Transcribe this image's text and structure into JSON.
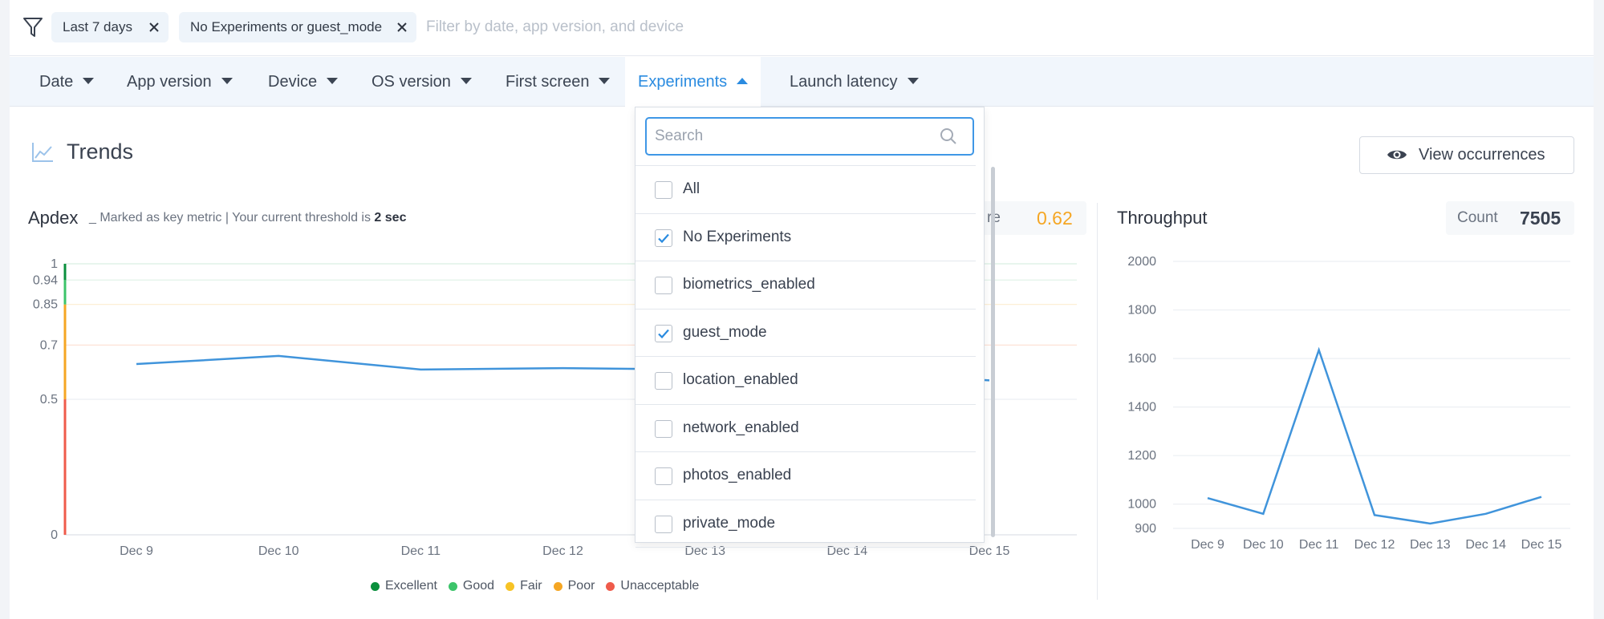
{
  "filters": {
    "chips": [
      {
        "label": "Last 7 days"
      },
      {
        "label": "No Experiments or guest_mode"
      }
    ],
    "placeholder": "Filter by date, app version, and device"
  },
  "nav": {
    "items": [
      {
        "label": "Date"
      },
      {
        "label": "App version"
      },
      {
        "label": "Device"
      },
      {
        "label": "OS version"
      },
      {
        "label": "First screen"
      },
      {
        "label": "Experiments",
        "active": true
      },
      {
        "label": "Launch latency"
      }
    ]
  },
  "trends": {
    "title": "Trends",
    "view_button": "View occurrences"
  },
  "apdex": {
    "title": "Apdex",
    "subtitle_prefix": "_ Marked as key metric | Your current threshold is ",
    "threshold": "2 sec",
    "score_label": "re",
    "score_value": "0.62",
    "score_color": "#f5a623",
    "legend": [
      {
        "label": "Excellent",
        "color": "#0a8f3c"
      },
      {
        "label": "Good",
        "color": "#3cc46a"
      },
      {
        "label": "Fair",
        "color": "#f7c325"
      },
      {
        "label": "Poor",
        "color": "#f5a623"
      },
      {
        "label": "Unacceptable",
        "color": "#ef5b4b"
      }
    ]
  },
  "throughput": {
    "title": "Throughput",
    "count_label": "Count",
    "count_value": "7505"
  },
  "experiments_dropdown": {
    "search_placeholder": "Search",
    "options": [
      {
        "label": "All",
        "checked": false
      },
      {
        "label": "No Experiments",
        "checked": true
      },
      {
        "label": "biometrics_enabled",
        "checked": false
      },
      {
        "label": "guest_mode",
        "checked": true
      },
      {
        "label": "location_enabled",
        "checked": false
      },
      {
        "label": "network_enabled",
        "checked": false
      },
      {
        "label": "photos_enabled",
        "checked": false
      },
      {
        "label": "private_mode",
        "checked": false
      }
    ]
  },
  "chart_data": [
    {
      "type": "line",
      "title": "Apdex",
      "x": [
        "Dec 9",
        "Dec 10",
        "Dec 11",
        "Dec 12",
        "Dec 13",
        "Dec 14",
        "Dec 15"
      ],
      "series": [
        {
          "values": [
            0.63,
            0.66,
            0.61,
            0.615,
            0.61,
            0.6,
            0.57
          ],
          "color": "#4094db"
        }
      ],
      "y_ticks": [
        0,
        0.5,
        0.7,
        0.85,
        0.94,
        1
      ],
      "y_tick_labels": [
        "0",
        "0.5",
        "0.7",
        "0.85",
        "0.94",
        "1"
      ],
      "ylim": [
        0,
        1
      ]
    },
    {
      "type": "line",
      "title": "Throughput",
      "x": [
        "Dec 9",
        "Dec 10",
        "Dec 11",
        "Dec 12",
        "Dec 13",
        "Dec 14",
        "Dec 15"
      ],
      "series": [
        {
          "values": [
            1025,
            960,
            1635,
            955,
            920,
            960,
            1030
          ],
          "color": "#4094db"
        }
      ],
      "y_ticks": [
        900,
        1000,
        1200,
        1400,
        1600,
        1800,
        2000
      ],
      "y_tick_labels": [
        "900",
        "1000",
        "1200",
        "1400",
        "1600",
        "1800",
        "2000"
      ],
      "ylim": [
        900,
        2000
      ]
    }
  ]
}
